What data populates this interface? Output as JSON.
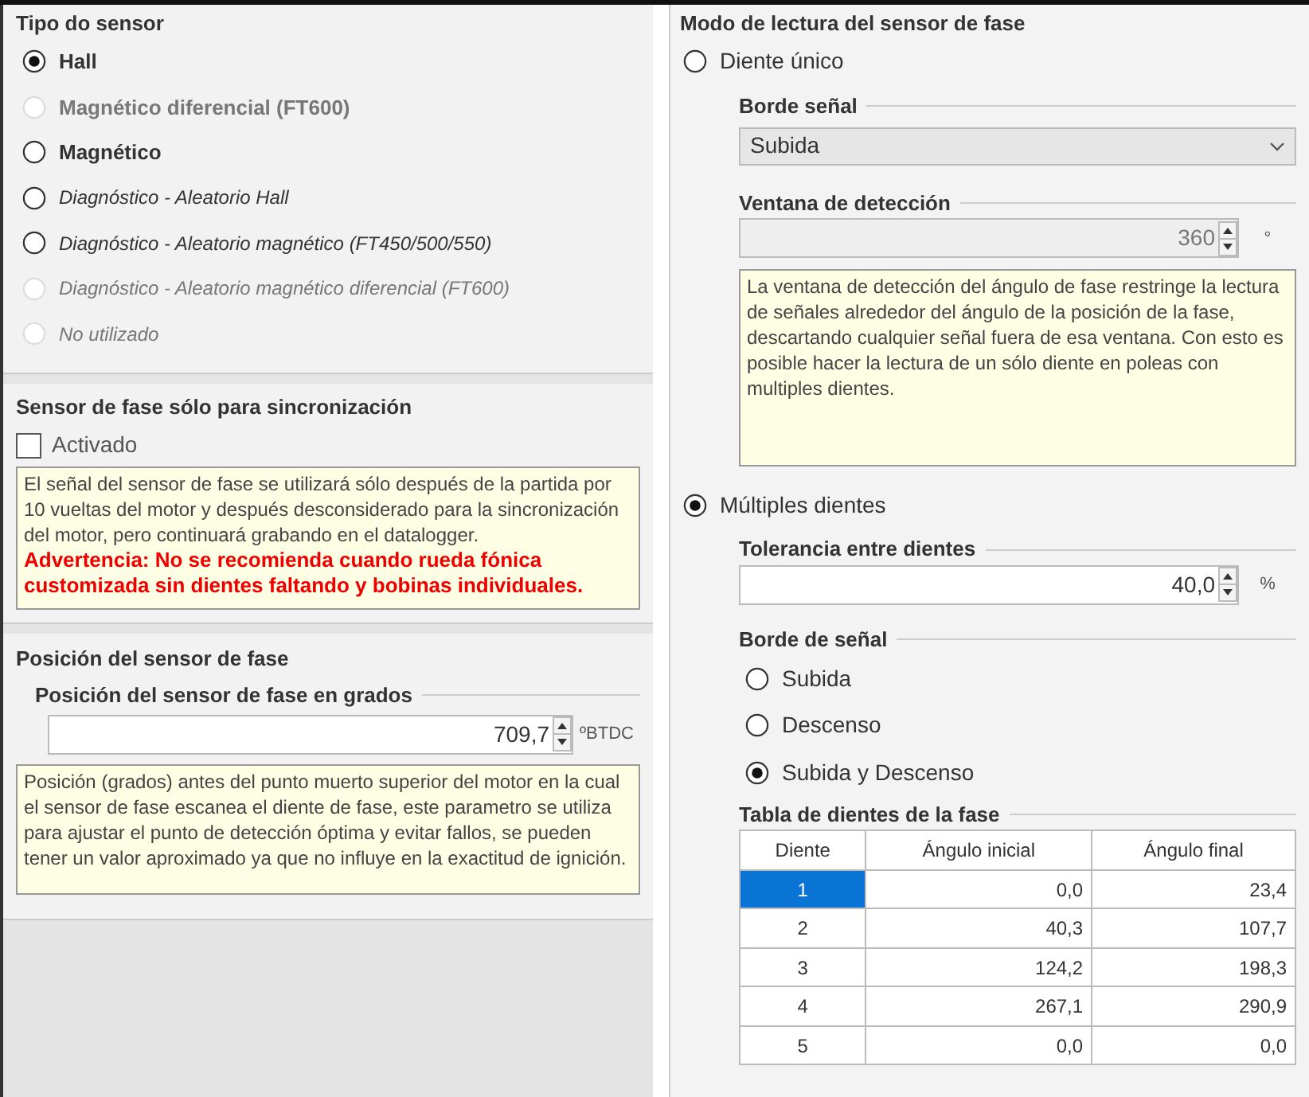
{
  "sensor_type": {
    "title": "Tipo do sensor",
    "options": [
      {
        "label": "Hall",
        "kind": "standard",
        "selected": true,
        "disabled": false
      },
      {
        "label": "Magnético diferencial (FT600)",
        "kind": "standard",
        "selected": false,
        "disabled": true
      },
      {
        "label": "Magnético",
        "kind": "standard",
        "selected": false,
        "disabled": false
      },
      {
        "label": "Diagnóstico - Aleatorio Hall",
        "kind": "diagnostic",
        "selected": false,
        "disabled": false
      },
      {
        "label": "Diagnóstico - Aleatorio magnético (FT450/500/550)",
        "kind": "diagnostic",
        "selected": false,
        "disabled": false
      },
      {
        "label": "Diagnóstico - Aleatorio magnético diferencial (FT600)",
        "kind": "diagnostic",
        "selected": false,
        "disabled": true
      },
      {
        "label": "No utilizado",
        "kind": "diagnostic",
        "selected": false,
        "disabled": true
      }
    ]
  },
  "sync": {
    "title": "Sensor de fase sólo para sincronización",
    "checkbox": {
      "label": "Activado",
      "checked": false
    },
    "note": "El señal del sensor de fase se utilizará sólo después de la partida por 10 vueltas del motor y después desconsiderado para la sincronización del motor, pero continuará grabando en el datalogger.",
    "warning": "Advertencia: No se recomienda cuando rueda fónica customizada sin dientes faltando y bobinas individuales."
  },
  "position": {
    "title": "Posición del sensor de fase",
    "field_label": "Posición del sensor de fase en grados",
    "value": "709,7",
    "unit": "ºBTDC",
    "note": "Posición (grados) antes del punto muerto superior del motor en la cual el sensor de fase escanea el diente de fase, este parametro se utiliza para ajustar el punto de detección óptima y evitar fallos, se pueden tener un valor aproximado ya que no influye en la exactitud de ignición."
  },
  "reading_mode": {
    "title": "Modo de lectura del sensor de fase",
    "single": {
      "label": "Diente único",
      "selected": false,
      "edge_label": "Borde señal",
      "edge_value": "Subida",
      "window_label": "Ventana de detección",
      "window_value": "360",
      "window_disabled": true,
      "window_unit": "°",
      "note": "La ventana de detección del ángulo de fase restringe la lectura de señales alrededor del ángulo de la posición de la fase, descartando cualquier señal fuera de esa ventana. Con esto es posible hacer la lectura de un sólo diente en poleas con multiples dientes."
    },
    "multiple": {
      "label": "Múltiples dientes",
      "selected": true,
      "tolerance_label": "Tolerancia entre dientes",
      "tolerance_value": "40,0",
      "tolerance_unit": "%",
      "edge_label": "Borde de señal",
      "edge_options": [
        {
          "label": "Subida",
          "selected": false
        },
        {
          "label": "Descenso",
          "selected": false
        },
        {
          "label": "Subida y Descenso",
          "selected": true
        }
      ],
      "table": {
        "title": "Tabla de dientes de la fase",
        "columns": [
          "Diente",
          "Ángulo inicial",
          "Ángulo final"
        ],
        "rows": [
          {
            "cells": [
              "1",
              "0,0",
              "23,4"
            ],
            "selected": true
          },
          {
            "cells": [
              "2",
              "40,3",
              "107,7"
            ],
            "selected": false
          },
          {
            "cells": [
              "3",
              "124,2",
              "198,3"
            ],
            "selected": false
          },
          {
            "cells": [
              "4",
              "267,1",
              "290,9"
            ],
            "selected": false
          },
          {
            "cells": [
              "5",
              "0,0",
              "0,0"
            ],
            "selected": false
          }
        ]
      }
    }
  }
}
